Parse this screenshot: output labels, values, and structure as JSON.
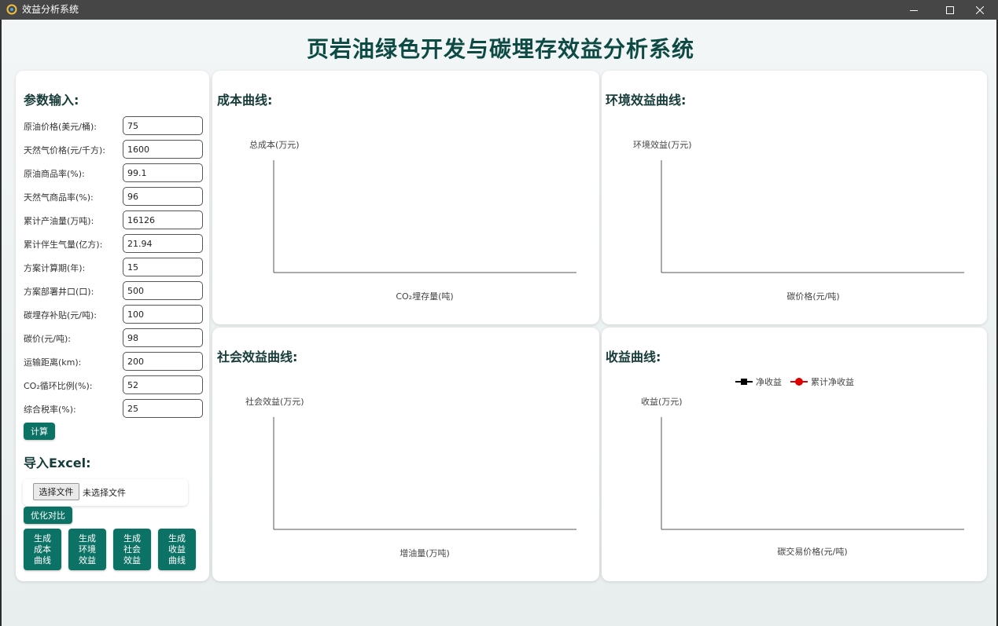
{
  "window": {
    "title": "效益分析系统"
  },
  "page_title": "页岩油绿色开发与碳埋存效益分析系统",
  "params": {
    "title": "参数输入:",
    "items": [
      {
        "label": "原油价格(美元/桶):",
        "value": "75"
      },
      {
        "label": "天然气价格(元/千方):",
        "value": "1600"
      },
      {
        "label": "原油商品率(%):",
        "value": "99.1"
      },
      {
        "label": "天然气商品率(%):",
        "value": "96"
      },
      {
        "label": "累计产油量(万吨):",
        "value": "16126"
      },
      {
        "label": "累计伴生气量(亿方):",
        "value": "21.94"
      },
      {
        "label": "方案计算期(年):",
        "value": "15"
      },
      {
        "label": "方案部署井口(口):",
        "value": "500"
      },
      {
        "label": "碳埋存补贴(元/吨):",
        "value": "100"
      },
      {
        "label": "碳价(元/吨):",
        "value": "98"
      },
      {
        "label": "运输距离(km):",
        "value": "200"
      },
      {
        "label": "CO₂循环比例(%):",
        "value": "52"
      },
      {
        "label": "综合税率(%):",
        "value": "25"
      }
    ],
    "calc_button": "计算"
  },
  "excel": {
    "title": "导入Excel:",
    "choose_button": "选择文件",
    "status": "未选择文件",
    "optimize_button": "优化对比"
  },
  "gen_buttons": [
    {
      "lines": [
        "生成",
        "成本",
        "曲线"
      ]
    },
    {
      "lines": [
        "生成",
        "环境",
        "效益"
      ]
    },
    {
      "lines": [
        "生成",
        "社会",
        "效益"
      ]
    },
    {
      "lines": [
        "生成",
        "收益",
        "曲线"
      ]
    }
  ],
  "charts": {
    "cost": {
      "title": "成本曲线:",
      "ylabel": "总成本(万元)",
      "xlabel": "CO₂埋存量(吨)"
    },
    "env": {
      "title": "环境效益曲线:",
      "ylabel": "环境效益(万元)",
      "xlabel": "碳价格(元/吨)"
    },
    "social": {
      "title": "社会效益曲线:",
      "ylabel": "社会效益(万元)",
      "xlabel": "增油量(万吨)"
    },
    "revenue": {
      "title": "收益曲线:",
      "ylabel": "收益(万元)",
      "xlabel": "碳交易价格(元/吨)",
      "legend": [
        "净收益",
        "累计净收益"
      ]
    }
  },
  "colors": {
    "accent": "#0c7265",
    "title": "#0e4a44",
    "series_net": "#000000",
    "series_cumulative": "#e00000"
  },
  "chart_data": [
    {
      "type": "line",
      "title": "成本曲线:",
      "xlabel": "CO₂埋存量(吨)",
      "ylabel": "总成本(万元)",
      "series": []
    },
    {
      "type": "line",
      "title": "环境效益曲线:",
      "xlabel": "碳价格(元/吨)",
      "ylabel": "环境效益(万元)",
      "series": []
    },
    {
      "type": "line",
      "title": "社会效益曲线:",
      "xlabel": "增油量(万吨)",
      "ylabel": "社会效益(万元)",
      "series": []
    },
    {
      "type": "line",
      "title": "收益曲线:",
      "xlabel": "碳交易价格(元/吨)",
      "ylabel": "收益(万元)",
      "legend_position": "top",
      "series": [
        {
          "name": "净收益",
          "values": []
        },
        {
          "name": "累计净收益",
          "values": []
        }
      ]
    }
  ]
}
